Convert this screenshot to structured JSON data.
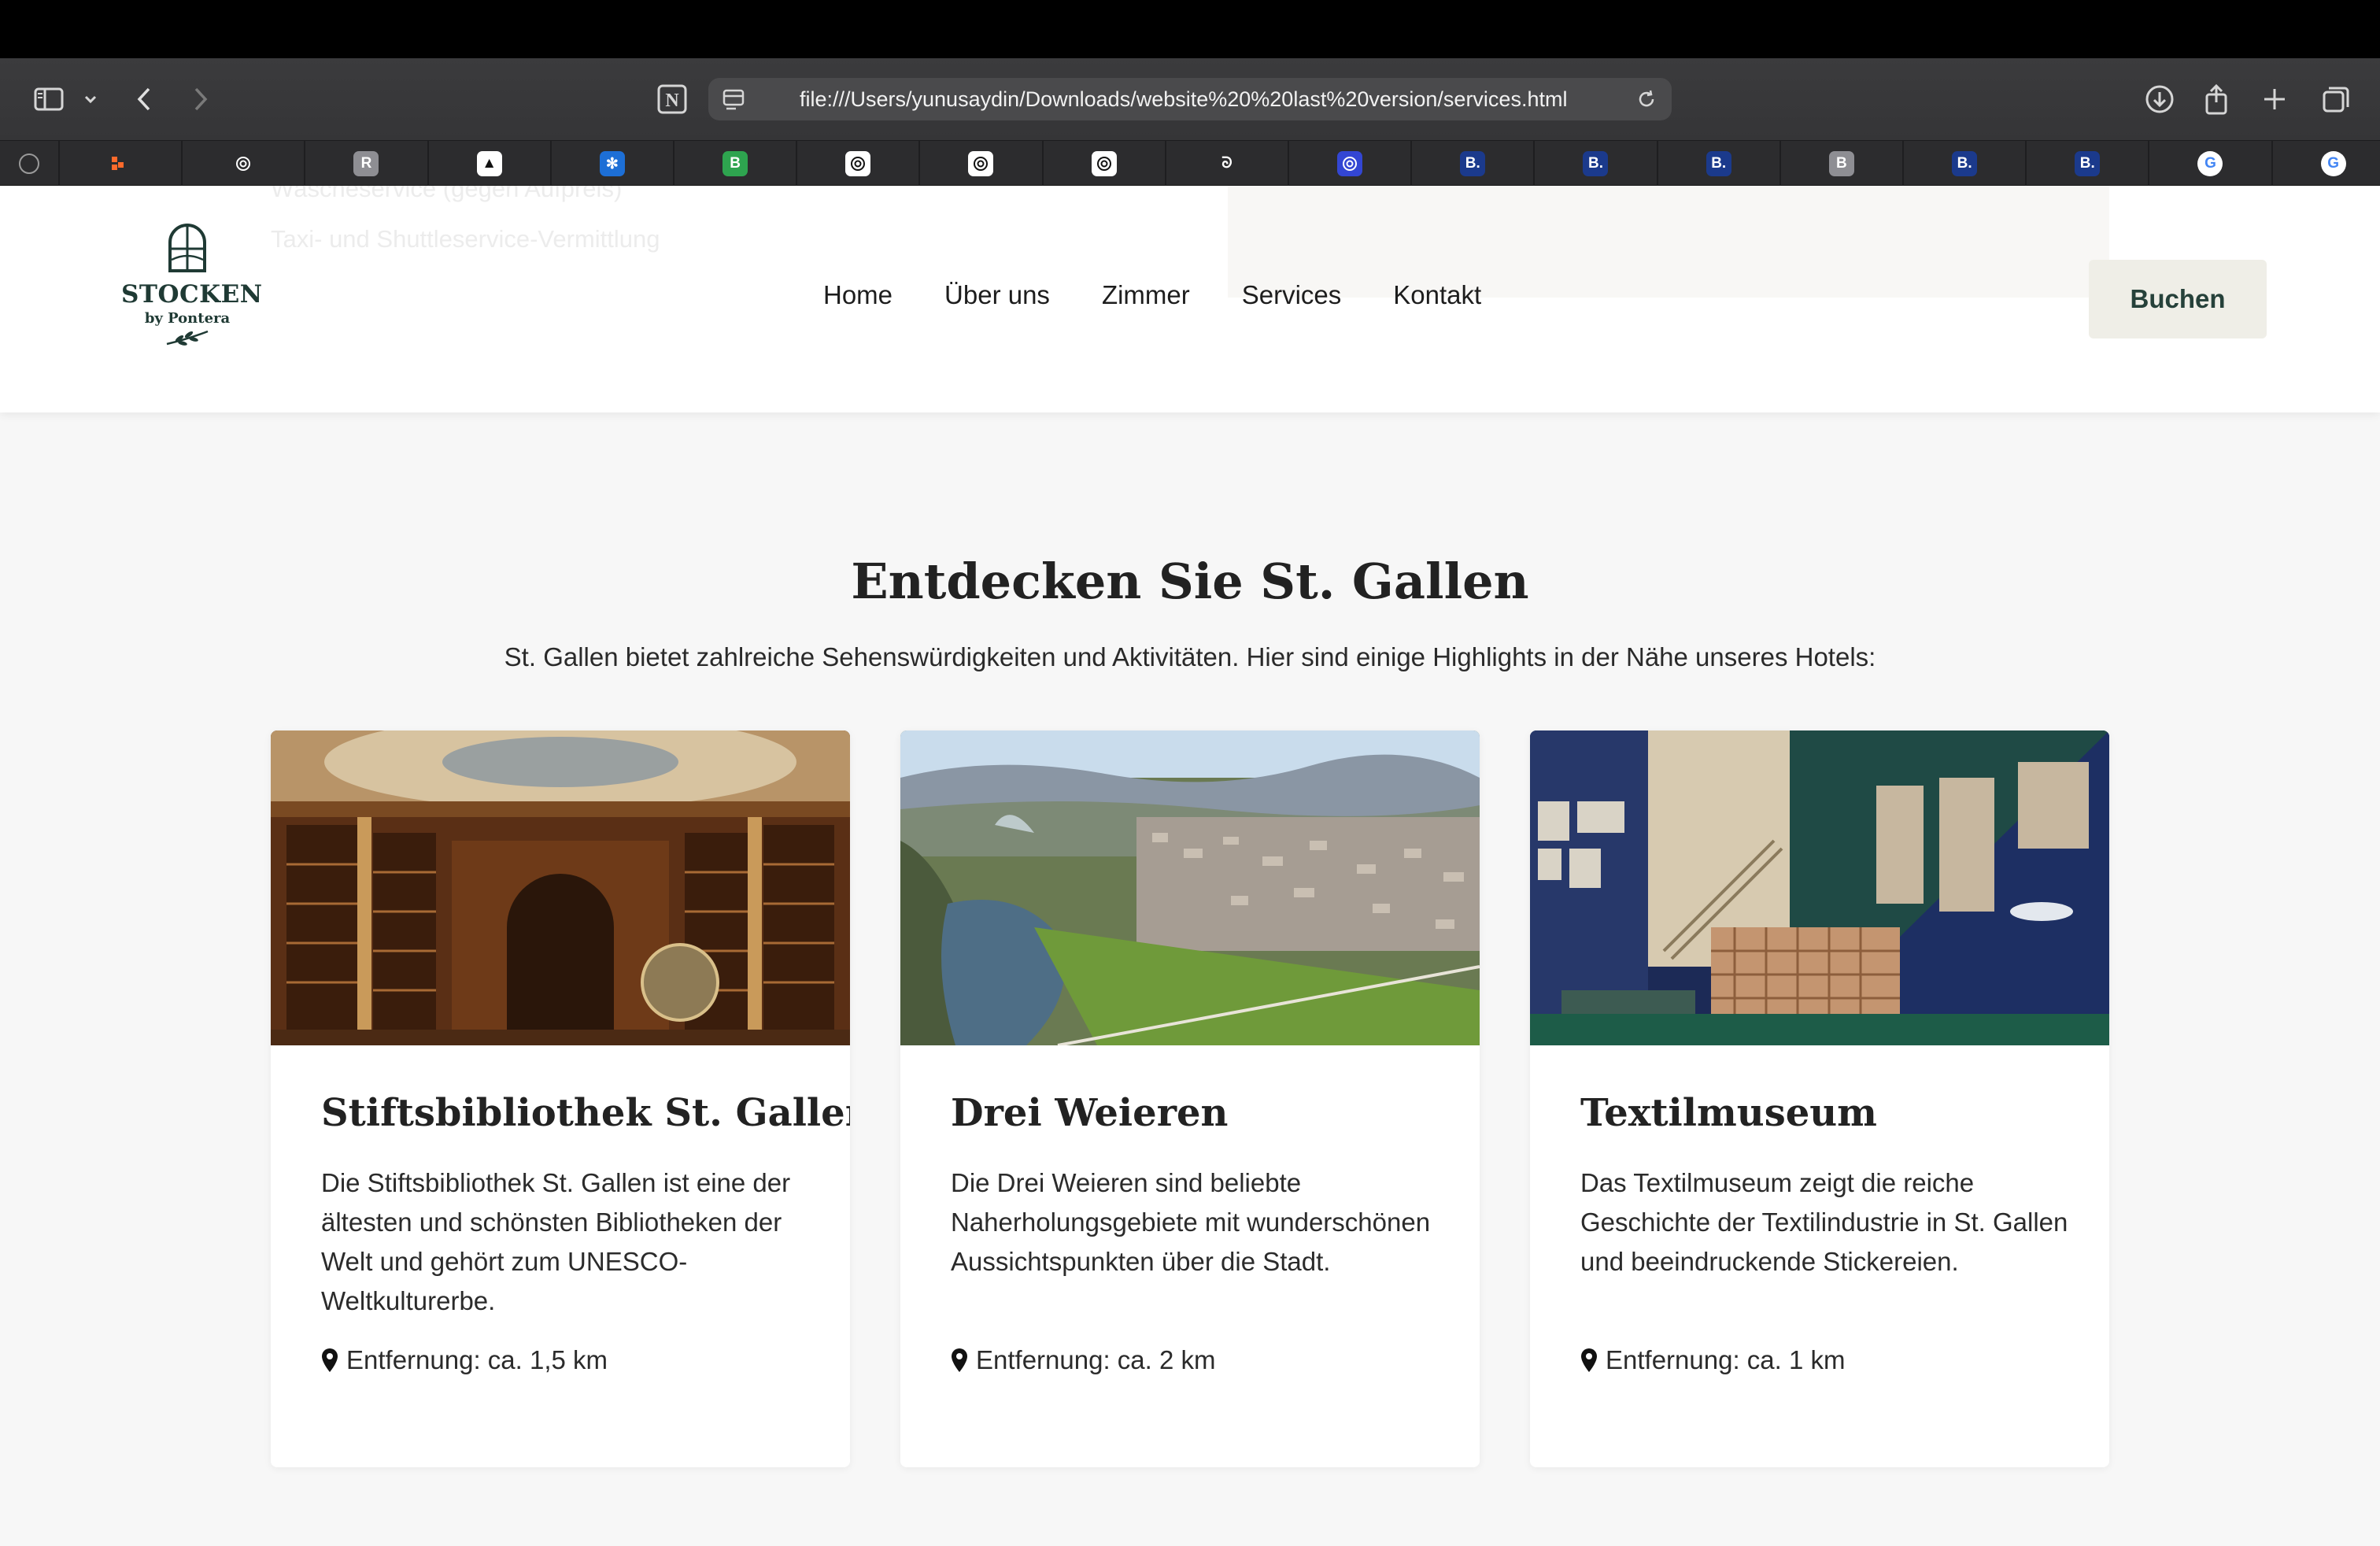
{
  "browser": {
    "url": "file:///Users/yunusaydin/Downloads/website%20%20last%20version/services.html",
    "tabs": [
      {
        "icon": "compass-icon",
        "bg": "#2c2c2e",
        "glyph": ""
      },
      {
        "icon": "orange-dots-icon",
        "bg": "#2c2c2e",
        "glyph": ""
      },
      {
        "icon": "openai-icon",
        "bg": "#2c2c2e",
        "glyph": ""
      },
      {
        "icon": "r-letter-icon",
        "bg": "#8e8e93",
        "glyph": "R"
      },
      {
        "icon": "triangle-icon",
        "bg": "#ffffff",
        "glyph": "▲"
      },
      {
        "icon": "butterfly-icon",
        "bg": "#1d6fd6",
        "glyph": "✻"
      },
      {
        "icon": "b-green-icon",
        "bg": "#2ea44f",
        "glyph": "B"
      },
      {
        "icon": "openai-icon",
        "bg": "#ffffff",
        "glyph": ""
      },
      {
        "icon": "openai-icon",
        "bg": "#ffffff",
        "glyph": ""
      },
      {
        "icon": "openai-icon",
        "bg": "#ffffff",
        "glyph": ""
      },
      {
        "icon": "swirl-icon",
        "bg": "#2c2c2e",
        "glyph": "ᘐ"
      },
      {
        "icon": "openai-blue-icon",
        "bg": "#3346d3",
        "glyph": ""
      },
      {
        "icon": "booking-icon",
        "bg": "#1b3a8c",
        "glyph": "B."
      },
      {
        "icon": "booking-icon",
        "bg": "#1b3a8c",
        "glyph": "B."
      },
      {
        "icon": "booking-icon",
        "bg": "#1b3a8c",
        "glyph": "B."
      },
      {
        "icon": "b-grey-icon",
        "bg": "#8e8e93",
        "glyph": "B"
      },
      {
        "icon": "booking-icon",
        "bg": "#1b3a8c",
        "glyph": "B."
      },
      {
        "icon": "booking-icon",
        "bg": "#1b3a8c",
        "glyph": "B."
      },
      {
        "icon": "google-icon",
        "bg": "#ffffff",
        "glyph": "G"
      },
      {
        "icon": "google-icon",
        "bg": "#ffffff",
        "glyph": "G"
      }
    ]
  },
  "header": {
    "ghost_line_1": "Wäscheservice (gegen Aufpreis)",
    "ghost_line_2": "Taxi- und Shuttleservice-Vermittlung",
    "logo_name": "STOCKEN",
    "logo_sub": "by Pontera",
    "nav": [
      "Home",
      "Über uns",
      "Zimmer",
      "Services",
      "Kontakt"
    ],
    "book_label": "Buchen"
  },
  "section": {
    "title": "Entdecken Sie St. Gallen",
    "subtitle": "St. Gallen bietet zahlreiche Sehenswürdigkeiten und Aktivitäten. Hier sind einige Highlights in der Nähe unseres Hotels:"
  },
  "cards": [
    {
      "title": "Stiftsbibliothek St. Gallen",
      "text": "Die Stiftsbibliothek St. Gallen ist eine der ältesten und schönsten Bibliotheken der Welt und gehört zum UNESCO-Weltkulturerbe.",
      "distance": "Entfernung: ca. 1,5 km",
      "image": "library-photo"
    },
    {
      "title": "Drei Weieren",
      "text": "Die Drei Weieren sind beliebte Naherholungsgebiete mit wunderschönen Aussichtspunkten über die Stadt.",
      "distance": "Entfernung: ca. 2 km",
      "image": "aerial-city-photo"
    },
    {
      "title": "Textilmuseum",
      "text": "Das Textilmuseum zeigt die reiche Geschichte der Textilindustrie in St. Gallen und beeindruckende Stickereien.",
      "distance": "Entfernung: ca. 1 km",
      "image": "museum-photo"
    }
  ],
  "colors": {
    "accent": "#26413a",
    "button_bg": "#efeee7",
    "page_bg": "#f7f7f7"
  }
}
